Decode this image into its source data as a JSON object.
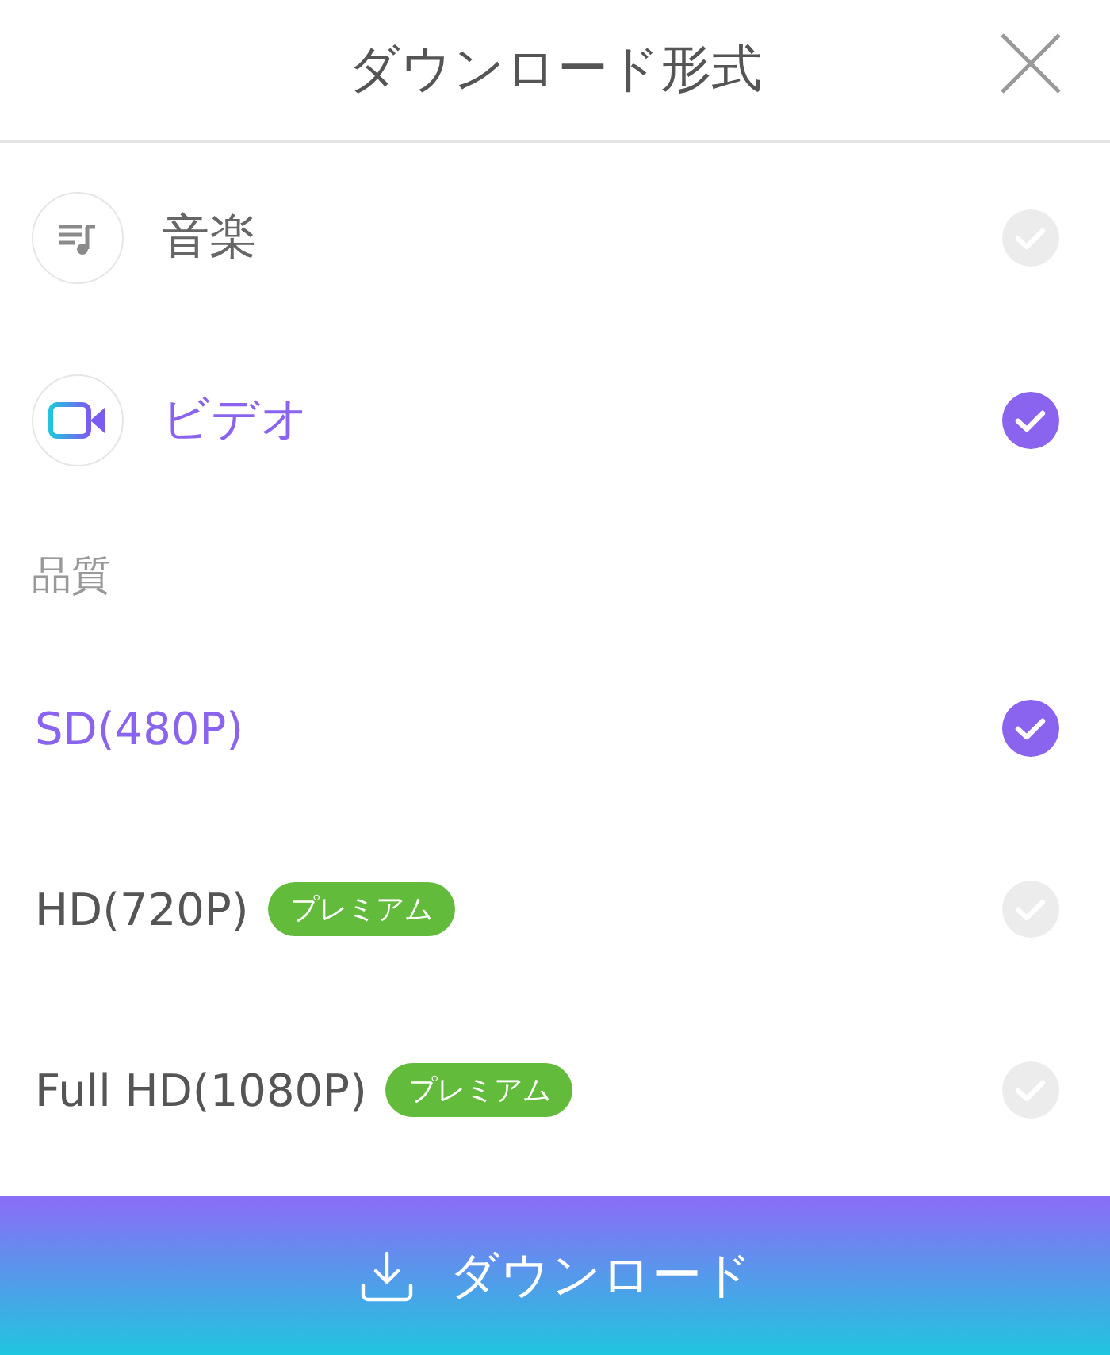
{
  "title": "ダウンロード形式",
  "formats": [
    {
      "kind": "music",
      "label": "音楽",
      "selected": false
    },
    {
      "kind": "video",
      "label": "ビデオ",
      "selected": true
    }
  ],
  "quality_heading": "品質",
  "qualities": [
    {
      "label": "SD(480P)",
      "selected": true
    },
    {
      "label": "HD(720P)",
      "badge": "プレミアム",
      "selected": false
    },
    {
      "label": "Full HD(1080P)",
      "badge": "プレミアム",
      "selected": false
    }
  ],
  "download_button": "ダウンロード"
}
